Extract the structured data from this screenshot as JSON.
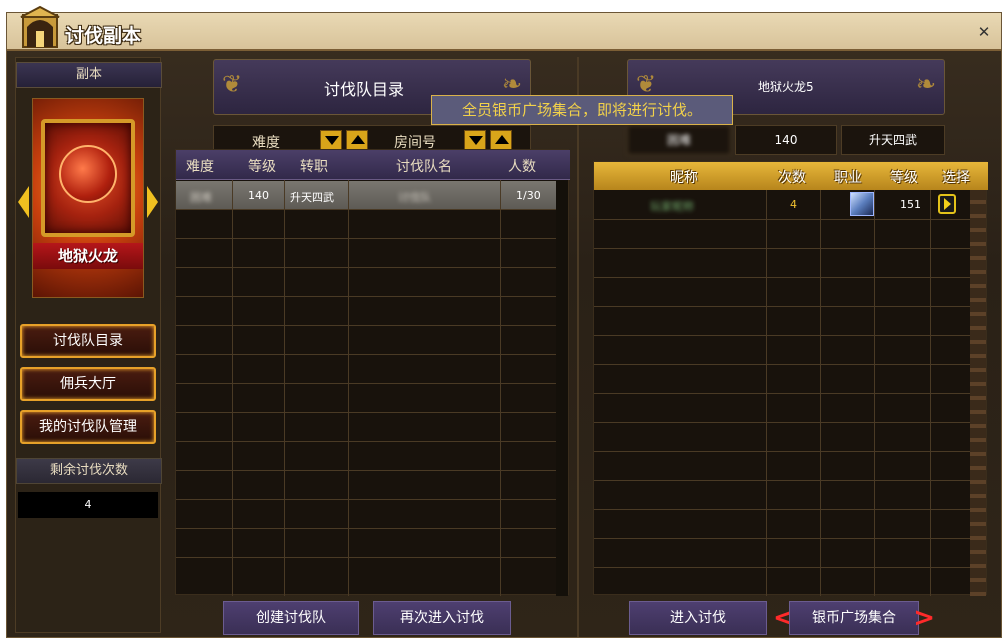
{
  "window": {
    "title": "讨伐副本",
    "close_symbol": "✕"
  },
  "sidebar": {
    "header": "副本",
    "boss_name": "地狱火龙",
    "buttons": [
      "讨伐队目录",
      "佣兵大厅",
      "我的讨伐队管理"
    ],
    "remaining_label": "剩余讨伐次数",
    "remaining_value": "4"
  },
  "team_directory": {
    "title": "讨伐队目录",
    "filters": {
      "difficulty_label": "难度",
      "room_label": "房间号"
    },
    "tooltip": "全员银币广场集合，即将进行讨伐。",
    "columns": [
      "难度",
      "等级",
      "转职",
      "讨伐队名",
      "人数"
    ],
    "rows": [
      {
        "difficulty": "困难",
        "level": "140",
        "job_tier": "升天四武",
        "team_name": "讨伐队",
        "members": "1/30"
      }
    ],
    "buttons": {
      "create": "创建讨伐队",
      "reenter": "再次进入讨伐"
    }
  },
  "team_detail": {
    "title": "地狱火龙5",
    "info": {
      "difficulty": "困难",
      "level": "140",
      "job_tier": "升天四武"
    },
    "columns": [
      "昵称",
      "次数",
      "职业",
      "等级",
      "选择"
    ],
    "members": [
      {
        "nickname": "玩家昵称",
        "count": "4",
        "job_icon": "sword-icon",
        "level": "151"
      }
    ],
    "buttons": {
      "enter": "进入讨伐",
      "gather": "银币广场集合"
    }
  },
  "colors": {
    "accent_gold": "#e7b73a",
    "tooltip_text": "#f3d24a",
    "alert_red": "#ff2a2a"
  }
}
